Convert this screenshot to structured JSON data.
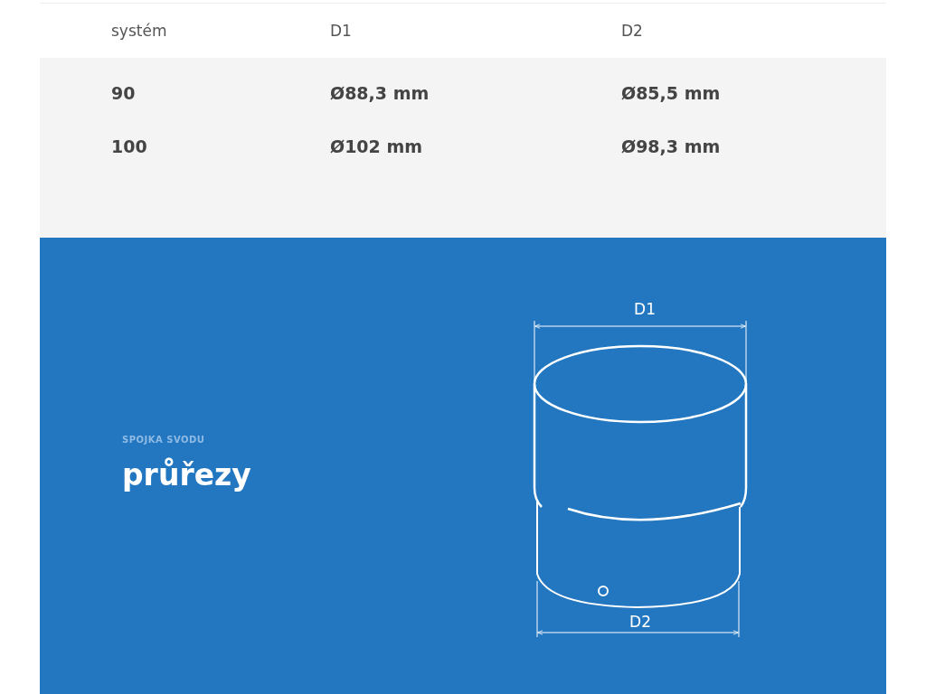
{
  "table": {
    "columns": [
      "systém",
      "D1",
      "D2"
    ],
    "rows": [
      [
        "90",
        "Ø88,3 mm",
        "Ø85,5 mm"
      ],
      [
        "100",
        "Ø102 mm",
        "Ø98,3 mm"
      ]
    ]
  },
  "section": {
    "eyebrow": "SPOJKA SVODU",
    "title": "průřezy",
    "diagram": {
      "top_label": "D1",
      "bottom_label": "D2"
    }
  }
}
